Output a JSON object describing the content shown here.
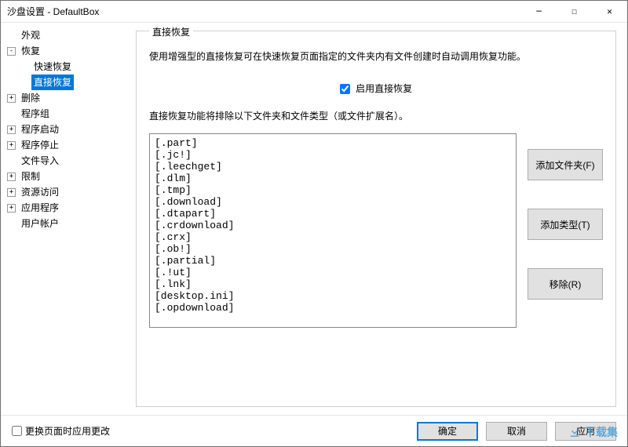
{
  "window": {
    "title": "沙盘设置 - DefaultBox"
  },
  "sidebar": {
    "items": [
      {
        "label": "外观",
        "toggle": ""
      },
      {
        "label": "恢复",
        "toggle": "-"
      },
      {
        "label": "快速恢复",
        "toggle": ""
      },
      {
        "label": "直接恢复",
        "toggle": "",
        "selected": true
      },
      {
        "label": "删除",
        "toggle": "+"
      },
      {
        "label": "程序组",
        "toggle": ""
      },
      {
        "label": "程序启动",
        "toggle": "+"
      },
      {
        "label": "程序停止",
        "toggle": "+"
      },
      {
        "label": "文件导入",
        "toggle": ""
      },
      {
        "label": "限制",
        "toggle": "+"
      },
      {
        "label": "资源访问",
        "toggle": "+"
      },
      {
        "label": "应用程序",
        "toggle": "+"
      },
      {
        "label": "用户帐户",
        "toggle": ""
      }
    ]
  },
  "panel": {
    "group_title": "直接恢复",
    "description1": "使用增强型的直接恢复可在快速恢复页面指定的文件夹内有文件创建时自动调用恢复功能。",
    "checkbox_label": "启用直接恢复",
    "checkbox_checked": true,
    "description2": "直接恢复功能将排除以下文件夹和文件类型（或文件扩展名）。",
    "list_items": [
      "[.part]",
      "[.jc!]",
      "[.leechget]",
      "[.dlm]",
      "[.tmp]",
      "[.download]",
      "[.dtapart]",
      "[.crdownload]",
      "[.crx]",
      "[.ob!]",
      "[.partial]",
      "[.!ut]",
      "[.lnk]",
      "[desktop.ini]",
      "[.opdownload]"
    ],
    "buttons": {
      "add_folder": "添加文件夹(F)",
      "add_type": "添加类型(T)",
      "remove": "移除(R)"
    }
  },
  "footer": {
    "apply_on_change": "更换页面时应用更改",
    "ok": "确定",
    "cancel": "取消",
    "apply": "应用"
  },
  "watermark": "下载集"
}
